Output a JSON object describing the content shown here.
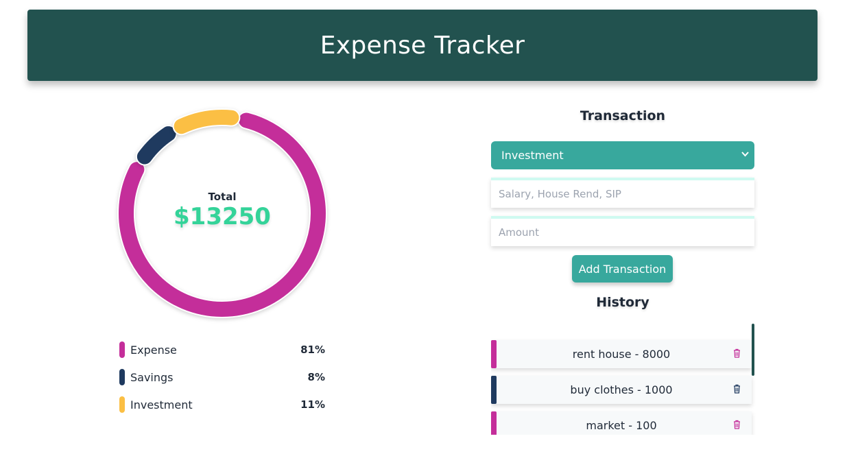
{
  "header": {
    "title": "Expense Tracker"
  },
  "summary": {
    "total_label": "Total",
    "total_value": "$13250"
  },
  "chart_data": {
    "type": "pie",
    "style": "donut",
    "title": "",
    "categories": [
      "Expense",
      "Savings",
      "Investment"
    ],
    "values": [
      81,
      8,
      11
    ],
    "colors": [
      "#c42e9a",
      "#1f3a5f",
      "#fbbf44"
    ]
  },
  "legend": [
    {
      "name": "Expense",
      "percent": "81%",
      "color": "#c42e9a"
    },
    {
      "name": "Savings",
      "percent": "8%",
      "color": "#1f3a5f"
    },
    {
      "name": "Investment",
      "percent": "11%",
      "color": "#fbbf44"
    }
  ],
  "transaction": {
    "title": "Transaction",
    "type_selected": "Investment",
    "title_placeholder": "Salary, House Rend, SIP",
    "amount_placeholder": "Amount",
    "add_button": "Add Transaction"
  },
  "history": {
    "title": "History",
    "items": [
      {
        "text": "rent house - 8000",
        "color": "#c42e9a"
      },
      {
        "text": "buy clothes - 1000",
        "color": "#1f3a5f"
      },
      {
        "text": "market - 100",
        "color": "#c42e9a"
      }
    ]
  },
  "icons": {
    "delete": "trash-icon",
    "dropdown": "chevron-down-icon"
  }
}
